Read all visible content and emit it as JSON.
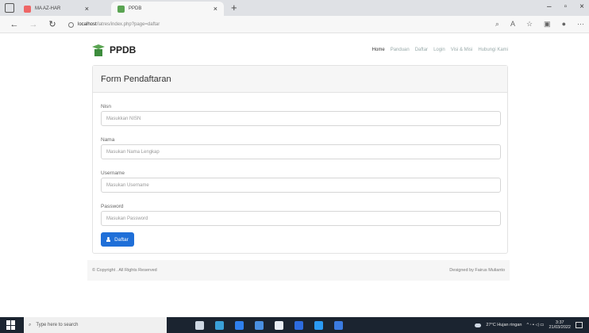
{
  "browser": {
    "tabs": [
      {
        "title": "MA AZ-HAR"
      },
      {
        "title": "PPDB"
      }
    ],
    "url_host": "localhost",
    "url_path": "/latres/index.php?page=daftar"
  },
  "site": {
    "brand": "PPDB",
    "nav": [
      "Home",
      "Panduan",
      "Daftar",
      "Login",
      "Visi & Misi",
      "Hubungi Kami"
    ]
  },
  "form": {
    "title": "Form Pendaftaran",
    "fields": [
      {
        "label": "Nisn",
        "placeholder": "Masukkan NISN"
      },
      {
        "label": "Nama",
        "placeholder": "Masukan Nama Lengkap"
      },
      {
        "label": "Username",
        "placeholder": "Masukan Username"
      },
      {
        "label": "Password",
        "placeholder": "Masukan Password"
      }
    ],
    "submit_label": "Daftar"
  },
  "footer": {
    "copyright": "© Copyright . All Rights Reserved",
    "designed": "Designed by Fairus Mulianto"
  },
  "taskbar": {
    "search_placeholder": "Type here to search",
    "weather": "27°C Hujan ringan",
    "time": "3:37",
    "date": "21/03/2022"
  }
}
